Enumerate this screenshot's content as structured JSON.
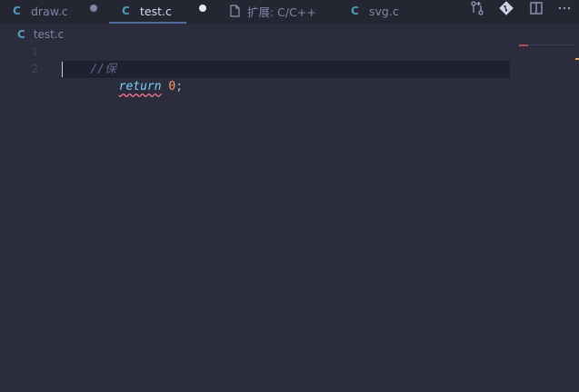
{
  "tabs": [
    {
      "label": "draw.c",
      "icon": "C",
      "dirty": true,
      "active": false
    },
    {
      "label": "test.c",
      "icon": "C",
      "dirty": true,
      "active": true
    },
    {
      "label": "扩展: C/C++",
      "icon": "file",
      "dirty": false,
      "active": false
    },
    {
      "label": "svg.c",
      "icon": "C",
      "dirty": false,
      "active": false
    }
  ],
  "breadcrumb": {
    "icon": "C",
    "file": "test.c"
  },
  "editor": {
    "line_numbers": [
      "1",
      "2"
    ],
    "lines": {
      "line1": {
        "comment": "//保"
      },
      "line2": {
        "indent": "    ",
        "keyword": "return",
        "space": " ",
        "number": "0",
        "punct": ";"
      }
    }
  },
  "actions": [
    "compare-changes-icon",
    "git-icon",
    "split-editor-icon",
    "more-actions-icon"
  ],
  "colors": {
    "background": "#2b2d3c",
    "tabbar": "#242632",
    "c_icon": "#519aba",
    "keyword": "#7dcfff",
    "number": "#ff9e64",
    "comment": "#5f6788"
  }
}
